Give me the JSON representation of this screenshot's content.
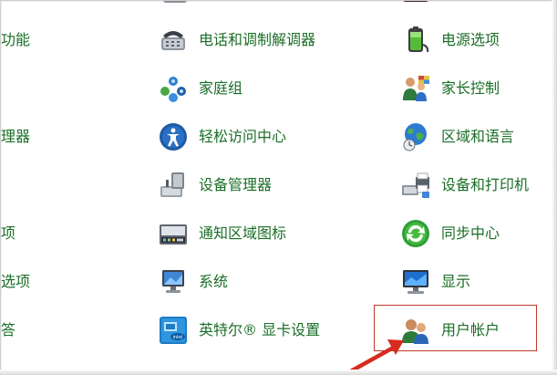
{
  "control_panel": {
    "left_column": [
      {
        "label": "功能"
      },
      {
        "label": "理器"
      },
      {
        "label": "项"
      },
      {
        "label": "选项"
      },
      {
        "label": "答"
      }
    ],
    "middle_column": [
      {
        "label": "电话和调制解调器",
        "icon": "phone-modem-icon"
      },
      {
        "label": "家庭组",
        "icon": "homegroup-icon"
      },
      {
        "label": "轻松访问中心",
        "icon": "ease-of-access-icon"
      },
      {
        "label": "设备管理器",
        "icon": "device-manager-icon"
      },
      {
        "label": "通知区域图标",
        "icon": "notification-area-icon"
      },
      {
        "label": "系统",
        "icon": "system-icon"
      },
      {
        "label": "英特尔® 显卡设置",
        "icon": "intel-graphics-icon"
      }
    ],
    "right_column": [
      {
        "label": "电源选项",
        "icon": "power-options-icon"
      },
      {
        "label": "家长控制",
        "icon": "parental-controls-icon"
      },
      {
        "label": "区域和语言",
        "icon": "region-language-icon"
      },
      {
        "label": "设备和打印机",
        "icon": "devices-printers-icon"
      },
      {
        "label": "同步中心",
        "icon": "sync-center-icon"
      },
      {
        "label": "显示",
        "icon": "display-icon"
      },
      {
        "label": "用户帐户",
        "icon": "user-accounts-icon"
      }
    ]
  },
  "colors": {
    "link_text": "#1a6e27",
    "highlight_border": "#c0392b",
    "arrow": "#d62b1f"
  }
}
